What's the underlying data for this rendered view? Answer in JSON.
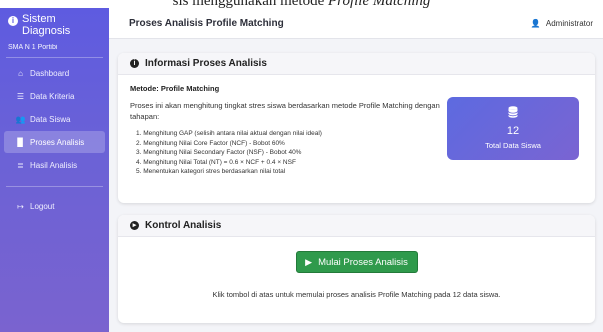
{
  "caption": {
    "prefix": "sis menggunakan metode ",
    "italic": "Profile Matching"
  },
  "sidebar": {
    "brand_title_line1": "Sistem",
    "brand_title_line2": "Diagnosis",
    "brand_sub": "SMA N 1 Portibi",
    "items": [
      {
        "label": "Dashboard",
        "icon": "home-icon",
        "active": false
      },
      {
        "label": "Data Kriteria",
        "icon": "list-icon",
        "active": false
      },
      {
        "label": "Data Siswa",
        "icon": "users-icon",
        "active": false
      },
      {
        "label": "Proses Analisis",
        "icon": "document-icon",
        "active": true
      },
      {
        "label": "Hasil Analisis",
        "icon": "chart-list-icon",
        "active": false
      }
    ],
    "logout": "Logout"
  },
  "topbar": {
    "title": "Proses Analisis Profile Matching",
    "user": "Administrator"
  },
  "info_card": {
    "title": "Informasi Proses Analisis",
    "method": "Metode: Profile Matching",
    "description": "Proses ini akan menghitung tingkat stres siswa berdasarkan metode Profile Matching dengan tahapan:",
    "steps": [
      "1. Menghitung GAP (selisih antara nilai aktual dengan nilai ideal)",
      "2. Menghitung Nilai Core Factor (NCF) - Bobot 60%",
      "3. Menghitung Nilai Secondary Factor (NSF) - Bobot 40%",
      "4. Menghitung Nilai Total (NT) = 0.6 × NCF + 0.4 × NSF",
      "5. Menentukan kategori stres berdasarkan nilai total"
    ],
    "stat_value": "12",
    "stat_label": "Total Data Siswa"
  },
  "control_card": {
    "title": "Kontrol Analisis",
    "button_label": "Mulai Proses Analisis",
    "hint": "Klik tombol di atas untuk memulai proses analisis Profile Matching pada 12 data siswa."
  },
  "colors": {
    "sidebar": "#5e5be0",
    "accent": "#6b62d6",
    "button": "#2f9a4c"
  }
}
